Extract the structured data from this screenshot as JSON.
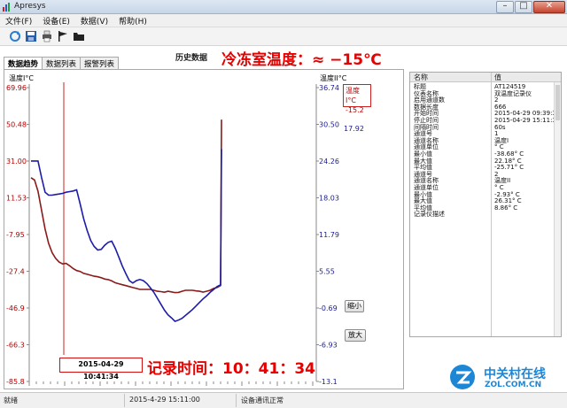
{
  "window": {
    "title": "Apresys",
    "minimize": "–",
    "maximize": "□",
    "close": "✕"
  },
  "menu": [
    "文件(F)",
    "设备(E)",
    "数据(V)",
    "帮助(H)"
  ],
  "toolbar": {
    "icons": [
      "refresh-icon",
      "save-icon",
      "print-icon",
      "flag-icon",
      "folder-icon"
    ]
  },
  "tabs": [
    "数据趋势",
    "数据列表",
    "报警列表"
  ],
  "chart_title": "历史数据",
  "annotation_temp": "冷冻室温度：≈ −15℃",
  "annotation_time": "记录时间：10：41：34",
  "cursor": {
    "time": "2015-04-29 10:41:34",
    "readout_label": "温度I°C",
    "readout_value": "-15.2",
    "readout2_value": "17.92"
  },
  "buttons": {
    "zoom_out": "缩小",
    "zoom_in": "放大"
  },
  "chart_data": {
    "type": "line",
    "y1": {
      "label": "温度I°C",
      "ticks": [
        "69.96",
        "50.48",
        "31.00",
        "11.53",
        "-7.95",
        "-27.4",
        "-46.9",
        "-66.3",
        "-85.8"
      ],
      "range": [
        -85.8,
        69.96
      ]
    },
    "y2": {
      "label": "温度II°C",
      "ticks": [
        "36.74",
        "30.50",
        "24.26",
        "18.03",
        "11.79",
        "5.55",
        "-0.69",
        "-6.93",
        "-13.1"
      ],
      "range": [
        -13.1,
        36.74
      ]
    },
    "series": [
      {
        "axis": "y1",
        "color": "#8b1a1a",
        "values": [
          22.2,
          21.0,
          15.0,
          5.0,
          -5.0,
          -12.5,
          -17.5,
          -20.5,
          -22.5,
          -23.5,
          -23.2,
          -24.5,
          -26.0,
          -27.0,
          -27.5,
          -28.5,
          -29.0,
          -29.5,
          -30.0,
          -30.3,
          -30.8,
          -31.5,
          -31.8,
          -32.5,
          -33.5,
          -34.0,
          -34.5,
          -35.0,
          -35.5,
          -36.0,
          -36.5,
          -37.0,
          -37.0,
          -37.0,
          -37.0,
          -37.5,
          -38.0,
          -38.2,
          -38.5,
          -38.0,
          -38.3,
          -38.7,
          -38.6,
          -38.0,
          -37.5,
          -37.5,
          -37.5,
          -37.8,
          -38.0,
          -38.4,
          -38.0,
          -37.5,
          -36.5,
          -36.0,
          -35.0,
          53.0
        ]
      },
      {
        "axis": "y2",
        "color": "#1c1ca8",
        "values": [
          24.3,
          24.3,
          24.3,
          21.5,
          19.0,
          18.5,
          18.5,
          18.6,
          18.7,
          18.8,
          19.0,
          19.1,
          19.2,
          19.4,
          17.0,
          14.5,
          12.5,
          10.8,
          9.8,
          9.2,
          9.3,
          10.0,
          10.5,
          10.7,
          9.5,
          8.0,
          6.5,
          5.2,
          4.0,
          3.6,
          4.0,
          4.2,
          4.0,
          3.5,
          2.8,
          2.0,
          1.0,
          0.0,
          -1.0,
          -1.8,
          -2.3,
          -2.9,
          -2.7,
          -2.4,
          -1.9,
          -1.4,
          -0.9,
          -0.3,
          0.3,
          0.9,
          1.4,
          2.0,
          2.5,
          3.0,
          3.3,
          26.3
        ]
      }
    ]
  },
  "properties": {
    "header_name": "名称",
    "header_value": "值",
    "rows": [
      [
        "标题",
        "AT124519"
      ],
      [
        "仪表名称",
        "双温度记录仪"
      ],
      [
        "启用通道数",
        "2"
      ],
      [
        "数据长度",
        "666"
      ],
      [
        "开始时间",
        "2015-04-29 09:39:34"
      ],
      [
        "停止时间",
        "2015-04-29 15:11:34"
      ],
      [
        "间隔时间",
        "60s"
      ],
      [
        "通道号",
        "1"
      ],
      [
        "通道名称",
        "温度I"
      ],
      [
        "通道单位",
        "° C"
      ],
      [
        "最小值",
        "-38.68° C"
      ],
      [
        "最大值",
        "22.18° C"
      ],
      [
        "平均值",
        "-25.71° C"
      ],
      [
        "通道号",
        "2"
      ],
      [
        "通道名称",
        "温度II"
      ],
      [
        "通道单位",
        "° C"
      ],
      [
        "最小值",
        "-2.93° C"
      ],
      [
        "最大值",
        "26.31° C"
      ],
      [
        "平均值",
        "8.86° C"
      ],
      [
        "记录仪描述",
        ""
      ]
    ]
  },
  "status": {
    "ready": "就绪",
    "datetime": "2015-4-29 15:11:00",
    "comm": "设备通讯正常"
  },
  "watermark": {
    "cn": "中关村在线",
    "en": "ZOL.COM.CN"
  }
}
